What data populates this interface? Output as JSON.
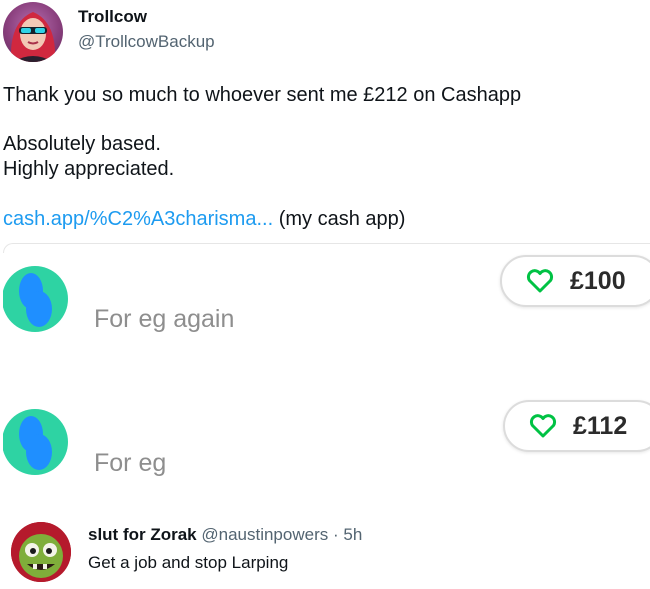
{
  "author": {
    "name": "Trollcow",
    "handle": "@TrollcowBackup"
  },
  "tweet": {
    "line1": "Thank you so much to whoever sent me £212 on Cashapp",
    "line2": "Absolutely based.",
    "line3": "Highly appreciated.",
    "link_text": "cash.app/%C2%A3charisma...",
    "link_suffix": " (my cash app)",
    "link_color": "#1d9bf0"
  },
  "embed": {
    "payments": [
      {
        "description": "For eg again",
        "amount": "£100",
        "icon": "heart-outline-icon"
      },
      {
        "description": "For eg",
        "amount": "£112",
        "icon": "heart-outline-icon"
      }
    ],
    "accent_green": "#00c244",
    "avatar_colors": [
      "#2ed3a3",
      "#1f8fff"
    ]
  },
  "reply": {
    "name": "slut for Zorak",
    "handle": "@naustinpowers",
    "separator": "·",
    "time": "5h",
    "text": "Get a job and stop Larping"
  }
}
